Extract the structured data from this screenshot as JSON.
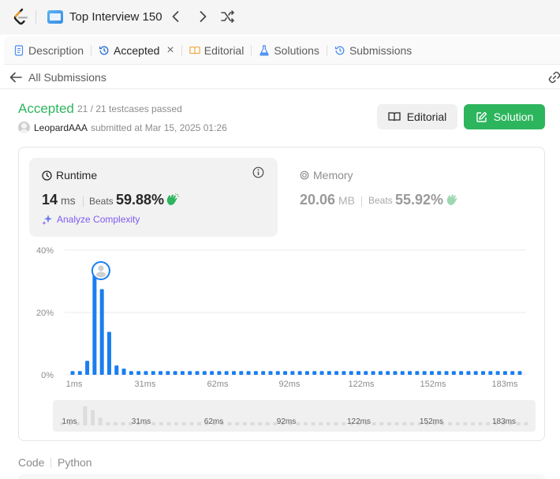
{
  "topbar": {
    "list_title": "Top Interview 150",
    "icons": [
      "leetcode-logo",
      "list-icon",
      "chevron-left-icon",
      "chevron-right-icon",
      "shuffle-icon"
    ]
  },
  "tabs": [
    {
      "label": "Description",
      "icon": "description-icon",
      "active": false
    },
    {
      "label": "Accepted",
      "icon": "history-icon",
      "active": true,
      "closable": true
    },
    {
      "label": "Editorial",
      "icon": "book-icon",
      "active": false
    },
    {
      "label": "Solutions",
      "icon": "flask-icon",
      "active": false
    },
    {
      "label": "Submissions",
      "icon": "history-icon",
      "active": false
    }
  ],
  "subheader": {
    "back_label": "All Submissions"
  },
  "result": {
    "status": "Accepted",
    "testcases": "21 / 21 testcases passed",
    "username": "LeopardAAA",
    "submitted": "submitted at Mar 15, 2025 01:26",
    "status_color": "#2db55d"
  },
  "buttons": {
    "editorial": "Editorial",
    "solution": "Solution"
  },
  "runtime": {
    "title": "Runtime",
    "value": "14",
    "unit": "ms",
    "beats_label": "Beats",
    "beats_value": "59.88%",
    "analyze_label": "Analyze Complexity"
  },
  "memory": {
    "title": "Memory",
    "value": "20.06",
    "unit": "MB",
    "beats_label": "Beats",
    "beats_value": "55.92%"
  },
  "chart_data": {
    "type": "bar",
    "xlabel": "",
    "ylabel": "",
    "y_ticks": [
      "40%",
      "20%",
      "0%"
    ],
    "ylim": [
      0,
      40
    ],
    "x_ticks": [
      "1ms",
      "31ms",
      "62ms",
      "92ms",
      "122ms",
      "152ms",
      "183ms"
    ],
    "grid": true,
    "highlighted_bar_index": 4,
    "bar_color": "#1a7ef0",
    "values": [
      1.2,
      1.2,
      4.5,
      34.5,
      27.5,
      13.8,
      3.0,
      2.0,
      1.2,
      1.2,
      1.2,
      1.2,
      1.2,
      1.2,
      1.2,
      1.2,
      1.2,
      1.2,
      1.2,
      1.2,
      1.2,
      1.2,
      1.2,
      1.2,
      1.2,
      1.2,
      1.2,
      1.2,
      1.2,
      1.2,
      1.2,
      1.2,
      1.2,
      1.2,
      1.2,
      1.2,
      1.2,
      1.2,
      1.2,
      1.2,
      1.2,
      1.2,
      1.2,
      1.2,
      1.2,
      1.2,
      1.2,
      1.2,
      1.2,
      1.2,
      1.2,
      1.2,
      1.2,
      1.2,
      1.2,
      1.2,
      1.2,
      1.2,
      1.2,
      1.2,
      1.2,
      1.2
    ]
  },
  "bottom": {
    "code_tab": "Code",
    "language_tab": "Python"
  }
}
